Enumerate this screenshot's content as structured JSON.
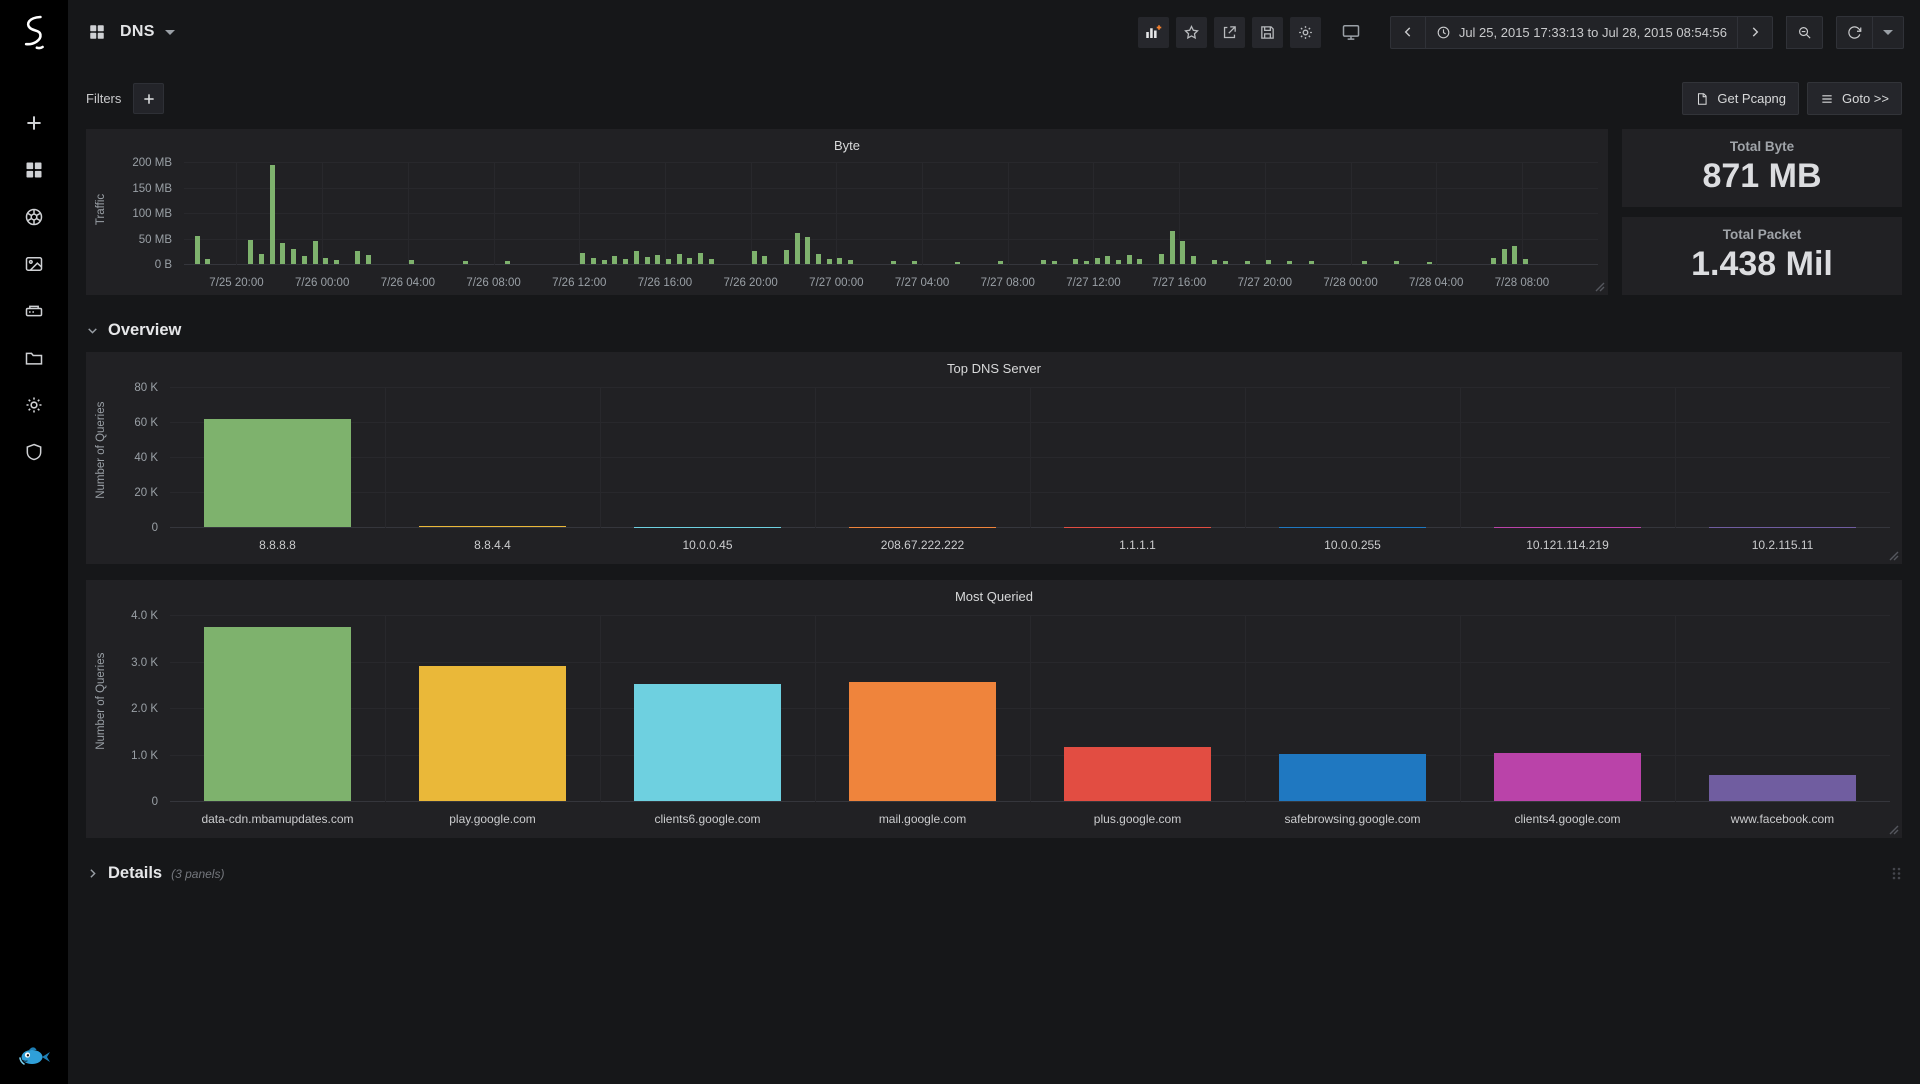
{
  "colors": {
    "page_bg": "#161719",
    "panel_bg": "#212124",
    "sidebar_bg": "#000000",
    "text": "#d8d9da",
    "muted": "#9aa0a6",
    "grid": "#28282c",
    "green": "#7eb26d",
    "add_panel_plus": "#f2802e"
  },
  "icons": {
    "sidebar": [
      "selks-logo",
      "add-icon",
      "dashboards-icon",
      "aperture-icon",
      "screenshot-icon",
      "storage-icon",
      "folder-icon",
      "gear-icon",
      "shield-icon",
      "fish-icon"
    ],
    "navbar": [
      "dashboard-grid-icon",
      "caret-down-icon",
      "add-panel-icon",
      "star-icon",
      "share-icon",
      "save-icon",
      "gear-icon",
      "monitor-icon",
      "chevron-left-icon",
      "clock-icon",
      "chevron-right-icon",
      "zoom-out-icon",
      "refresh-icon",
      "caret-down-icon"
    ]
  },
  "navbar": {
    "dashboard_title": "DNS",
    "time_range": "Jul 25, 2015 17:33:13 to Jul 28, 2015 08:54:56"
  },
  "toolbar": {
    "filters_label": "Filters",
    "get_pcapng_label": "Get Pcapng",
    "goto_label": "Goto >>"
  },
  "stats": [
    {
      "title": "Total Byte",
      "value": "871 MB"
    },
    {
      "title": "Total Packet",
      "value": "1.438 Mil"
    }
  ],
  "rows": [
    {
      "label": "Overview",
      "state": "expanded"
    },
    {
      "label": "Details",
      "suffix": "(3 panels)",
      "state": "collapsed"
    }
  ],
  "chart_data": [
    {
      "id": "byte",
      "type": "bar",
      "title": "Byte",
      "ylabel": "Traffic",
      "ylim": [
        0,
        200
      ],
      "yticks": [
        "0 B",
        "50 MB",
        "100 MB",
        "150 MB",
        "200 MB"
      ],
      "bar_color": "#7eb26d",
      "x_slots": 132,
      "xtick_start": 4.9,
      "xtick_step": 8,
      "xtick_labels": [
        "7/25 20:00",
        "7/26 00:00",
        "7/26 04:00",
        "7/26 08:00",
        "7/26 12:00",
        "7/26 16:00",
        "7/26 20:00",
        "7/27 00:00",
        "7/27 04:00",
        "7/27 08:00",
        "7/27 12:00",
        "7/27 16:00",
        "7/27 20:00",
        "7/28 00:00",
        "7/28 04:00",
        "7/28 08:00"
      ],
      "points_unit": "MB",
      "points": [
        [
          1,
          55
        ],
        [
          2,
          10
        ],
        [
          6,
          48
        ],
        [
          7,
          20
        ],
        [
          8,
          195
        ],
        [
          9,
          42
        ],
        [
          10,
          30
        ],
        [
          11,
          15
        ],
        [
          12,
          45
        ],
        [
          13,
          12
        ],
        [
          14,
          8
        ],
        [
          16,
          25
        ],
        [
          17,
          18
        ],
        [
          21,
          8
        ],
        [
          26,
          6
        ],
        [
          30,
          5
        ],
        [
          37,
          22
        ],
        [
          38,
          12
        ],
        [
          39,
          8
        ],
        [
          40,
          15
        ],
        [
          41,
          10
        ],
        [
          42,
          25
        ],
        [
          43,
          14
        ],
        [
          44,
          18
        ],
        [
          45,
          10
        ],
        [
          46,
          20
        ],
        [
          47,
          12
        ],
        [
          48,
          22
        ],
        [
          49,
          10
        ],
        [
          53,
          25
        ],
        [
          54,
          15
        ],
        [
          56,
          28
        ],
        [
          57,
          60
        ],
        [
          58,
          52
        ],
        [
          59,
          20
        ],
        [
          60,
          10
        ],
        [
          61,
          12
        ],
        [
          62,
          8
        ],
        [
          66,
          6
        ],
        [
          68,
          5
        ],
        [
          72,
          4
        ],
        [
          76,
          6
        ],
        [
          80,
          8
        ],
        [
          81,
          5
        ],
        [
          83,
          10
        ],
        [
          84,
          6
        ],
        [
          85,
          12
        ],
        [
          86,
          15
        ],
        [
          87,
          8
        ],
        [
          88,
          18
        ],
        [
          89,
          10
        ],
        [
          91,
          20
        ],
        [
          92,
          65
        ],
        [
          93,
          45
        ],
        [
          94,
          15
        ],
        [
          96,
          8
        ],
        [
          97,
          6
        ],
        [
          99,
          5
        ],
        [
          101,
          8
        ],
        [
          103,
          6
        ],
        [
          105,
          5
        ],
        [
          110,
          6
        ],
        [
          113,
          5
        ],
        [
          116,
          4
        ],
        [
          122,
          12
        ],
        [
          123,
          30
        ],
        [
          124,
          35
        ],
        [
          125,
          10
        ]
      ]
    },
    {
      "id": "top-dns-server",
      "type": "bar",
      "title": "Top DNS Server",
      "ylabel": "Number of Queries",
      "ylim": [
        0,
        80000
      ],
      "yticks": [
        "0",
        "20 K",
        "40 K",
        "60 K",
        "80 K"
      ],
      "categories": [
        "8.8.8.8",
        "8.8.4.4",
        "10.0.0.45",
        "208.67.222.222",
        "1.1.1.1",
        "10.0.0.255",
        "10.121.114.219",
        "10.2.115.11"
      ],
      "values": [
        62000,
        800,
        250,
        180,
        120,
        90,
        70,
        50
      ],
      "colors": [
        "#7eb26d",
        "#eab839",
        "#6ed0e0",
        "#ef843c",
        "#e24d42",
        "#1f78c1",
        "#ba43a9",
        "#705da0"
      ]
    },
    {
      "id": "most-queried",
      "type": "bar",
      "title": "Most Queried",
      "ylabel": "Number of Queries",
      "ylim": [
        0,
        4000
      ],
      "yticks": [
        "0",
        "1.0 K",
        "2.0 K",
        "3.0 K",
        "4.0 K"
      ],
      "categories": [
        "data-cdn.mbamupdates.com",
        "play.google.com",
        "clients6.google.com",
        "mail.google.com",
        "plus.google.com",
        "safebrowsing.google.com",
        "clients4.google.com",
        "www.facebook.com"
      ],
      "values": [
        3750,
        2900,
        2520,
        2550,
        1170,
        1010,
        1040,
        560
      ],
      "colors": [
        "#7eb26d",
        "#eab839",
        "#6ed0e0",
        "#ef843c",
        "#e24d42",
        "#1f78c1",
        "#ba43a9",
        "#705da0"
      ]
    }
  ]
}
